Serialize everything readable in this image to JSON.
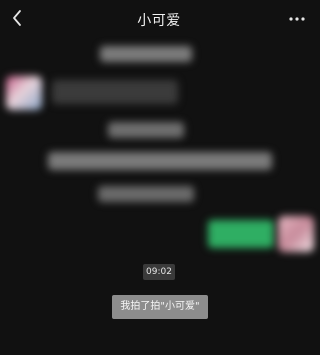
{
  "header": {
    "title": "小可爱",
    "back_icon": "chevron-left-icon",
    "more_icon": "more-dots-icon"
  },
  "chat": {
    "time_badge": "09:02",
    "pat_notice": "我拍了拍\"小可爱\""
  },
  "colors": {
    "background": "#111111",
    "sent_bubble": "#2fae63",
    "received_bubble": "#3a3a3a",
    "system_gray": "#8d8d8d"
  }
}
